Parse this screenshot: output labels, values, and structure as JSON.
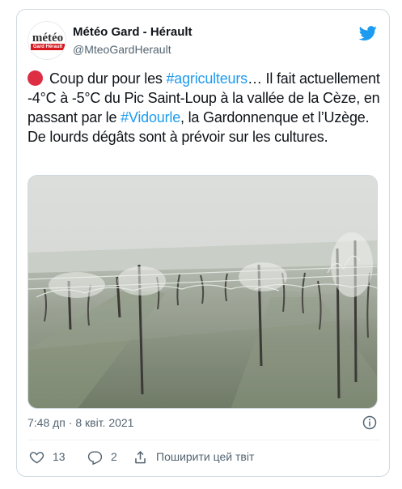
{
  "author": {
    "name": "Météo Gard - Hérault",
    "handle": "@MteoGardHerault",
    "avatar_word": "météo",
    "avatar_band": "Gard Hérault"
  },
  "tweet": {
    "emoji": "red-circle",
    "t1": "Coup dur pour les ",
    "tag1": "#agriculteurs",
    "t2": "… Il fait actuellement -4°C à -5°C du Pic Saint-Loup à la vallée de la Cèze, en passant par le ",
    "tag2": "#Vidourle",
    "t3": ", la Gardonnenque et l’Uzège. De lourds dégâts sont à prévoir sur les cultures."
  },
  "meta": {
    "timestamp": "7:48 дп · 8 квіт. 2021"
  },
  "actions": {
    "likes": "13",
    "replies": "2",
    "share_label": "Поширити цей твіт"
  },
  "icons": {
    "logo": "twitter-bird-icon",
    "info": "info-icon",
    "like": "heart-icon",
    "reply": "reply-icon",
    "share": "share-icon"
  },
  "colors": {
    "twitter_blue": "#1d9bf0",
    "hashtag": "#1d9bf0",
    "muted": "#536471",
    "border": "#cfd9de",
    "red_dot": "#dd2e44"
  }
}
